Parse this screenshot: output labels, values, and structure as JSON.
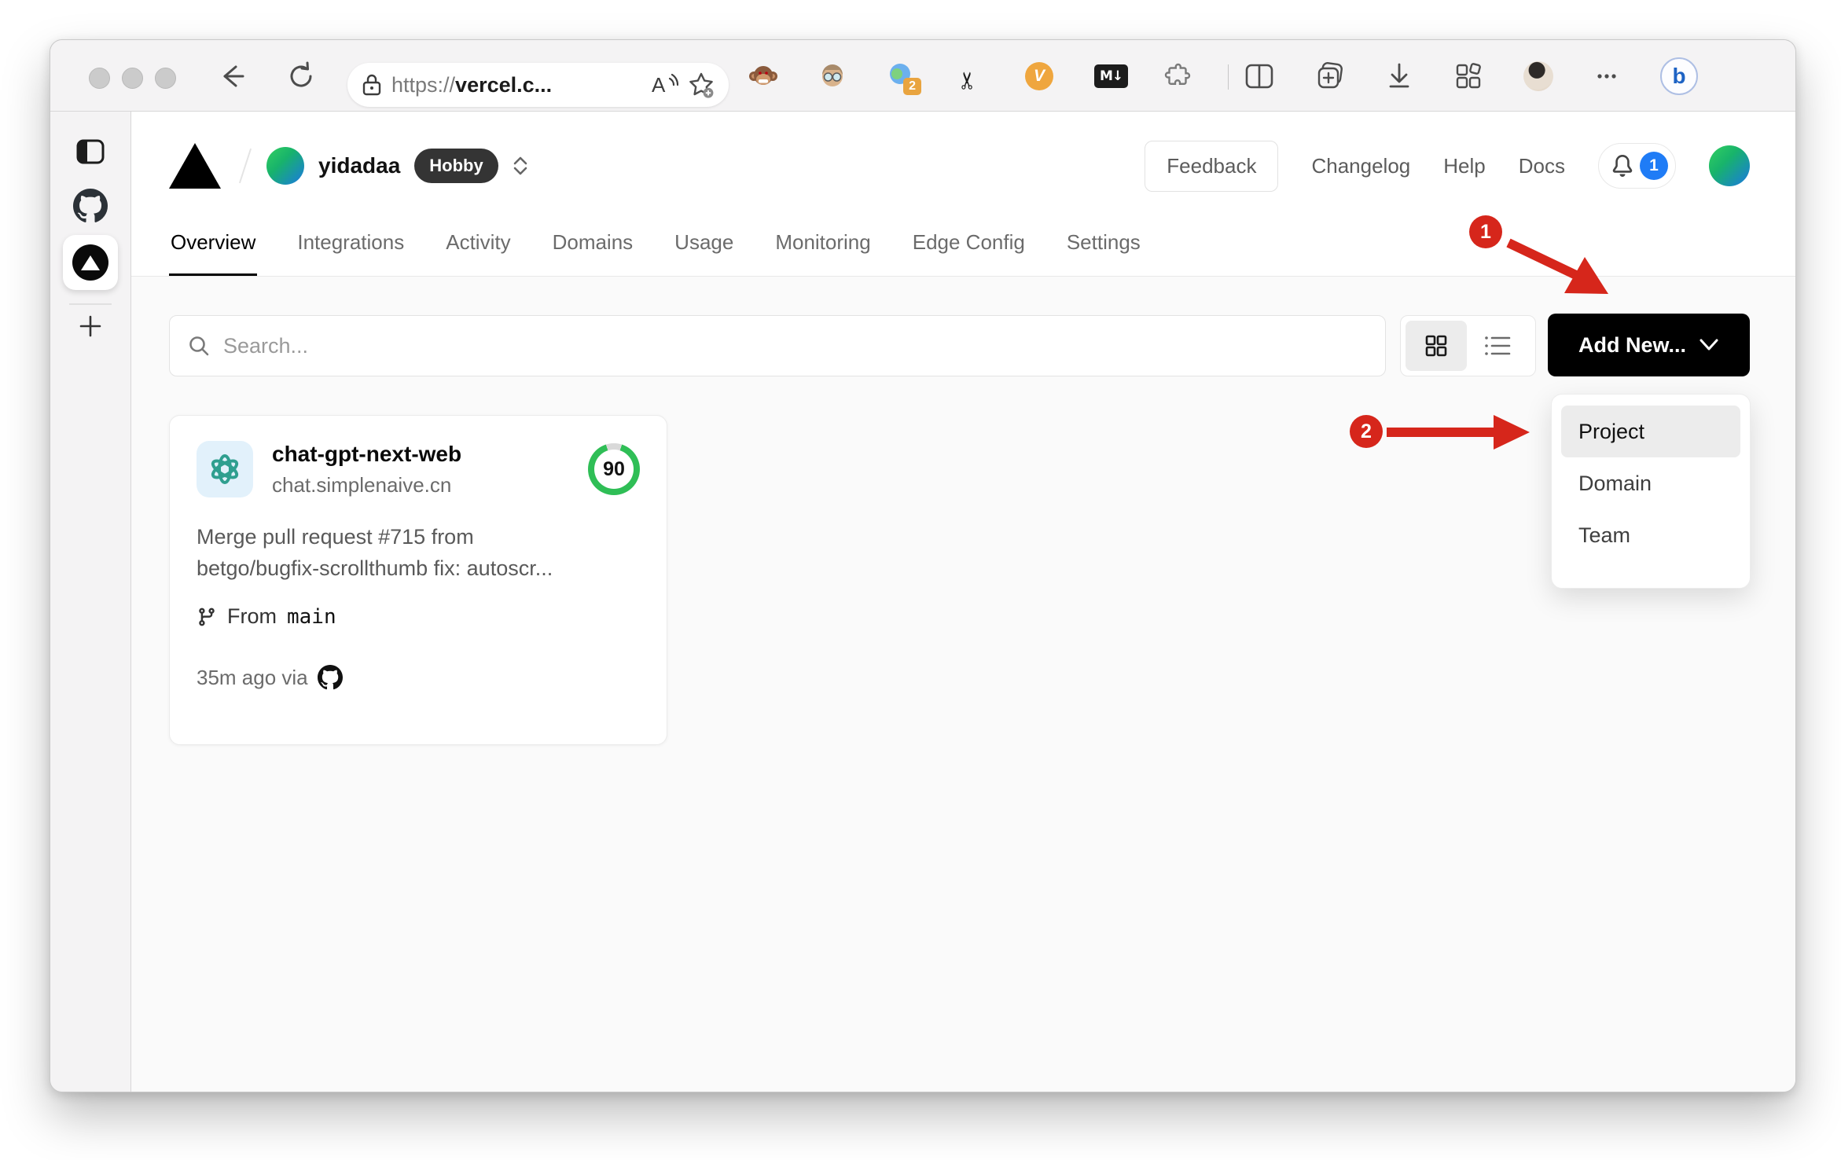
{
  "browser": {
    "url_scheme": "https://",
    "url_host": "vercel.c...",
    "read_aloud_label": "A",
    "scissors_glyph": "✂",
    "markdown_ext_label": "M↓",
    "v_ext_label": "V",
    "extension_badge": "2"
  },
  "header": {
    "team_name": "yidadaa",
    "plan_badge": "Hobby",
    "feedback": "Feedback",
    "changelog": "Changelog",
    "help": "Help",
    "docs": "Docs",
    "notification_count": "1"
  },
  "tabs": [
    "Overview",
    "Integrations",
    "Activity",
    "Domains",
    "Usage",
    "Monitoring",
    "Edge Config",
    "Settings"
  ],
  "toolbar": {
    "search_placeholder": "Search...",
    "add_new": "Add New..."
  },
  "card": {
    "name": "chat-gpt-next-web",
    "domain": "chat.simplenaive.cn",
    "score": "90",
    "commit_line1": "Merge pull request #715 from",
    "commit_line2": "betgo/bugfix-scrollthumb fix: autoscr...",
    "from_label": "From",
    "branch": "main",
    "meta": "35m ago via"
  },
  "dropdown": {
    "items": [
      "Project",
      "Domain",
      "Team"
    ],
    "selected": "Project"
  },
  "annotations": {
    "step1": "1",
    "step2": "2"
  },
  "colors": {
    "annotation_red": "#d6261b",
    "ring_green": "#2fbe56",
    "badge_blue": "#1f7cf6",
    "add_new_bg": "#000000"
  }
}
